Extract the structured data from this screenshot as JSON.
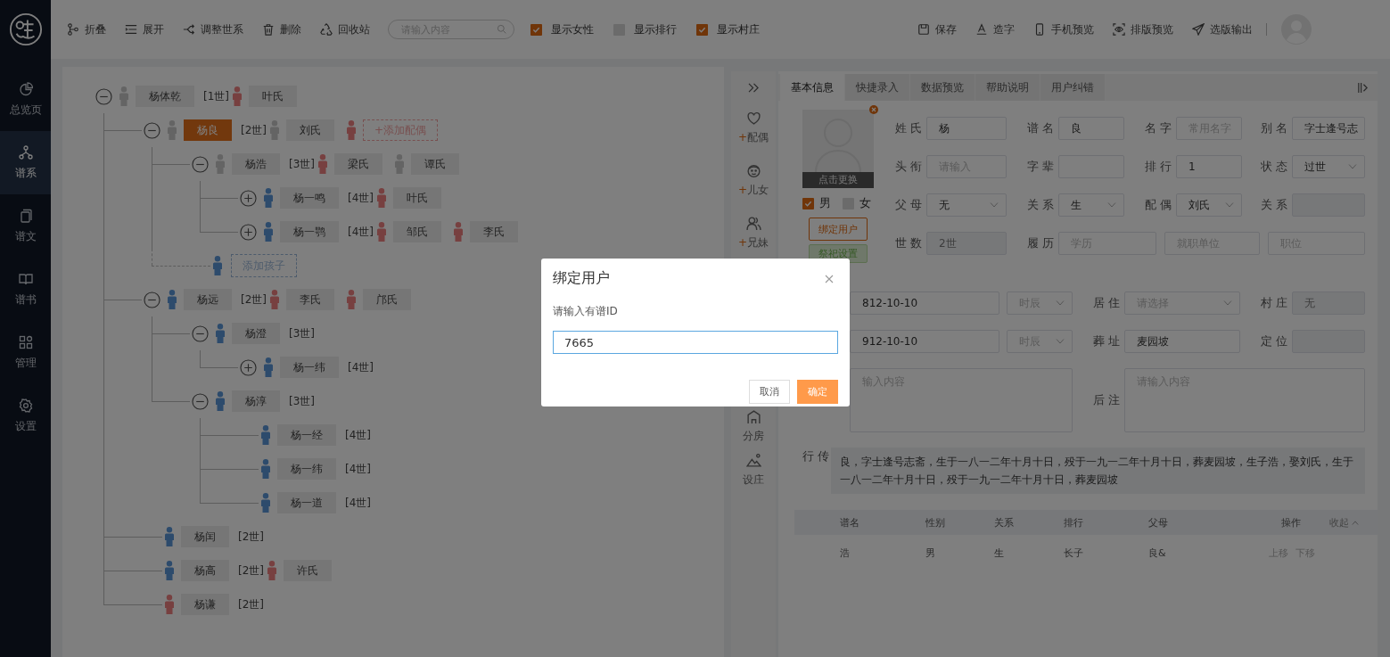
{
  "sidebar": {
    "items": [
      {
        "label": "总览页",
        "selected": false
      },
      {
        "label": "谱系",
        "selected": true
      },
      {
        "label": "谱文",
        "selected": false
      },
      {
        "label": "谱书",
        "selected": false
      },
      {
        "label": "管理",
        "selected": false
      },
      {
        "label": "设置",
        "selected": false
      }
    ]
  },
  "toolbar": {
    "actions": [
      {
        "label": "折叠"
      },
      {
        "label": "展开"
      },
      {
        "label": "调整世系"
      },
      {
        "label": "删除"
      },
      {
        "label": "回收站"
      }
    ],
    "search": {
      "placeholder": "请输入内容"
    },
    "toggles": [
      {
        "label": "显示女性",
        "checked": true
      },
      {
        "label": "显示排行",
        "checked": false
      },
      {
        "label": "显示村庄",
        "checked": true
      }
    ],
    "right_actions": [
      {
        "label": "保存"
      },
      {
        "label": "造字"
      },
      {
        "label": "手机预览"
      },
      {
        "label": "排版预览"
      },
      {
        "label": "选版输出"
      }
    ]
  },
  "tree": {
    "kind": "unknown",
    "expanded": true,
    "name": "杨体乾",
    "generation": "[1世]",
    "selected": false,
    "spouses": [
      {
        "name": "叶氏",
        "kind": "female"
      }
    ],
    "children": [
      {
        "kind": "unknown",
        "expanded": true,
        "name": "杨良",
        "generation": "[2世]",
        "selected": true,
        "spouses": [
          {
            "name": "刘氏",
            "kind": "unknown"
          }
        ],
        "add_spouse": {
          "kind": "female",
          "label": "+添加配偶"
        },
        "children": [
          {
            "kind": "unknown",
            "expanded": true,
            "name": "杨浩",
            "generation": "[3世]",
            "selected": false,
            "spouses": [
              {
                "name": "梁氏",
                "kind": "female"
              },
              {
                "name": "谭氏",
                "kind": "unknown"
              }
            ],
            "children": [
              {
                "kind": "male",
                "expanded": false,
                "name": "杨一鸣",
                "generation": "[4世]",
                "selected": false,
                "spouses": [
                  {
                    "name": "叶氏",
                    "kind": "female"
                  }
                ]
              },
              {
                "kind": "male",
                "expanded": false,
                "name": "杨一鹗",
                "generation": "[4世]",
                "selected": false,
                "spouses": [
                  {
                    "name": "邹氏",
                    "kind": "female"
                  },
                  {
                    "name": "李氏",
                    "kind": "female"
                  }
                ]
              }
            ]
          },
          {
            "kind": "add",
            "label": "添加孩子"
          }
        ]
      },
      {
        "kind": "male",
        "expanded": true,
        "name": "杨远",
        "generation": "[2世]",
        "selected": false,
        "spouses": [
          {
            "name": "李氏",
            "kind": "female"
          },
          {
            "name": "邝氏",
            "kind": "female"
          }
        ],
        "children": [
          {
            "kind": "male",
            "expanded": true,
            "name": "杨澄",
            "generation": "[3世]",
            "selected": false,
            "children": [
              {
                "kind": "male",
                "expanded": false,
                "name": "杨一纬",
                "generation": "[4世]",
                "selected": false
              }
            ]
          },
          {
            "kind": "male",
            "expanded": true,
            "name": "杨淳",
            "generation": "[3世]",
            "selected": false,
            "children": [
              {
                "kind": "male",
                "name": "杨一经",
                "generation": "[4世]",
                "selected": false
              },
              {
                "kind": "male",
                "name": "杨一纬",
                "generation": "[4世]",
                "selected": false
              },
              {
                "kind": "male",
                "name": "杨一道",
                "generation": "[4世]",
                "selected": false
              }
            ]
          }
        ]
      },
      {
        "kind": "male",
        "name": "杨闰",
        "generation": "[2世]",
        "selected": false
      },
      {
        "kind": "male",
        "name": "杨高",
        "generation": "[2世]",
        "selected": false,
        "spouses": [
          {
            "name": "许氏",
            "kind": "female"
          }
        ]
      },
      {
        "kind": "female",
        "name": "杨谦",
        "generation": "[2世]",
        "selected": false
      }
    ]
  },
  "action_column": {
    "items": [
      {
        "plus": "+",
        "label": "配偶"
      },
      {
        "plus": "+",
        "label": "儿女"
      },
      {
        "plus": "+",
        "label": "兄妹"
      },
      {
        "label": "分房"
      },
      {
        "label": "设庄"
      }
    ]
  },
  "editor": {
    "tabs": [
      {
        "label": "基本信息",
        "selected": true
      },
      {
        "label": "快捷录入",
        "selected": false
      },
      {
        "label": "数据预览",
        "selected": false
      },
      {
        "label": "帮助说明",
        "selected": false
      },
      {
        "label": "用户纠错",
        "selected": false
      }
    ],
    "photo": {
      "caption": "点击更换"
    },
    "gender": [
      {
        "label": "男",
        "checked": true
      },
      {
        "label": "女",
        "checked": false
      }
    ],
    "buttons": [
      {
        "label": "绑定用户",
        "kind": "outline"
      },
      {
        "label": "祭祀设置",
        "kind": "green"
      }
    ],
    "top_rows": [
      [
        {
          "label": "姓氏",
          "kind": "input",
          "value": "杨"
        },
        {
          "label": "谱名",
          "kind": "input",
          "value": "良"
        },
        {
          "label": "名字",
          "kind": "input",
          "placeholder": "常用名字"
        },
        {
          "label": "别名",
          "kind": "input",
          "value": "字士逢号志"
        }
      ],
      [
        {
          "label": "头衔",
          "kind": "input",
          "placeholder": "请输入"
        },
        {
          "label": "字辈",
          "kind": "input"
        },
        {
          "label": "排行",
          "kind": "input",
          "value": "1"
        },
        {
          "label": "状态",
          "kind": "select",
          "value": "过世"
        }
      ],
      [
        {
          "label": "父母",
          "kind": "select",
          "value": "无"
        },
        {
          "label": "关系",
          "kind": "select",
          "value": "生"
        },
        {
          "label": "配偶",
          "kind": "select",
          "value": "刘氏"
        },
        {
          "label": "关系",
          "kind": "readonly"
        }
      ],
      [
        {
          "label": "世数",
          "kind": "readonly",
          "placeholder": "2世"
        },
        {
          "label": "履历",
          "kind": "input",
          "placeholder": "学历"
        },
        {
          "kind": "input",
          "placeholder": "就职单位"
        },
        {
          "kind": "input",
          "placeholder": "职位"
        }
      ]
    ],
    "lower_rows": [
      [
        {
          "kind": "input",
          "value": "812-10-10"
        },
        {
          "kind": "select",
          "placeholder": "时辰"
        },
        {
          "label": "居住",
          "kind": "select",
          "placeholder": "请选择"
        },
        {
          "label": "村庄",
          "kind": "readonly",
          "placeholder": "无"
        }
      ],
      [
        {
          "kind": "input",
          "value": "912-10-10"
        },
        {
          "kind": "select",
          "placeholder": "时辰"
        },
        {
          "label": "葬址",
          "kind": "input",
          "value": "麦园坡"
        },
        {
          "label": "定位",
          "kind": "readonly"
        }
      ],
      [
        {
          "kind": "textarea",
          "placeholder": "输入内容"
        },
        {
          "label": "后注",
          "kind": "textarea",
          "placeholder": "请输入内容"
        }
      ]
    ],
    "biography": {
      "label": "行传",
      "text": "良，字士逢号志斋，生于一八一二年十月十日，殁于一九一二年十月十日，葬麦园坡，生子浩，娶刘氏，生于一八一二年十月十日，殁于一九一二年十月十日，葬麦园坡"
    },
    "children_table": {
      "columns": [
        "谱名",
        "性别",
        "关系",
        "排行",
        "父母",
        "操作"
      ],
      "collapse": "收起",
      "rows": [
        {
          "cells": [
            "浩",
            "男",
            "生",
            "长子",
            "良&"
          ],
          "actions": [
            "上移",
            "下移"
          ]
        }
      ]
    }
  },
  "dialog": {
    "title": "绑定用户",
    "label": "请输入有谱ID",
    "value": "7665",
    "buttons": [
      {
        "label": "取消",
        "kind": "default"
      },
      {
        "label": "确定",
        "kind": "primary"
      }
    ]
  }
}
